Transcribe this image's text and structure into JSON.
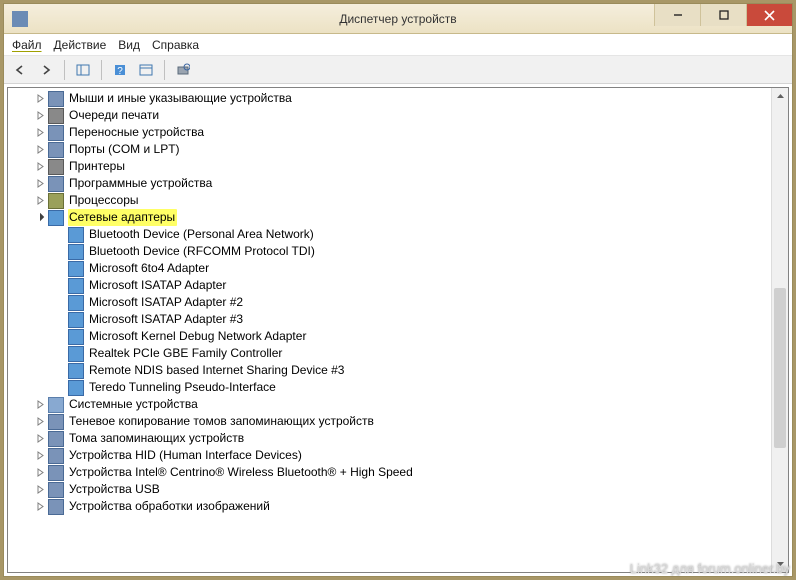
{
  "window": {
    "title": "Диспетчер устройств"
  },
  "menu": {
    "file": "Файл",
    "action": "Действие",
    "view": "Вид",
    "help": "Справка"
  },
  "tree": {
    "categories": [
      {
        "label": "Мыши и иные указывающие устройства",
        "expanded": false,
        "icon": "mouse"
      },
      {
        "label": "Очереди печати",
        "expanded": false,
        "icon": "printer"
      },
      {
        "label": "Переносные устройства",
        "expanded": false,
        "icon": "portable"
      },
      {
        "label": "Порты (COM и LPT)",
        "expanded": false,
        "icon": "port"
      },
      {
        "label": "Принтеры",
        "expanded": false,
        "icon": "printer"
      },
      {
        "label": "Программные устройства",
        "expanded": false,
        "icon": "soft"
      },
      {
        "label": "Процессоры",
        "expanded": false,
        "icon": "chip"
      },
      {
        "label": "Сетевые адаптеры",
        "expanded": true,
        "highlight": true,
        "icon": "net",
        "children": [
          {
            "label": "Bluetooth Device (Personal Area Network)"
          },
          {
            "label": "Bluetooth Device (RFCOMM Protocol TDI)"
          },
          {
            "label": "Microsoft 6to4 Adapter"
          },
          {
            "label": "Microsoft ISATAP Adapter"
          },
          {
            "label": "Microsoft ISATAP Adapter #2"
          },
          {
            "label": "Microsoft ISATAP Adapter #3"
          },
          {
            "label": "Microsoft Kernel Debug Network Adapter"
          },
          {
            "label": "Realtek PCIe GBE Family Controller"
          },
          {
            "label": "Remote NDIS based Internet Sharing Device #3"
          },
          {
            "label": "Teredo Tunneling Pseudo-Interface"
          }
        ]
      },
      {
        "label": "Системные устройства",
        "expanded": false,
        "icon": "sys"
      },
      {
        "label": "Теневое копирование томов запоминающих устройств",
        "expanded": false,
        "icon": "disk"
      },
      {
        "label": "Тома запоминающих устройств",
        "expanded": false,
        "icon": "disk"
      },
      {
        "label": "Устройства HID (Human Interface Devices)",
        "expanded": false,
        "icon": "hid"
      },
      {
        "label": "Устройства Intel® Centrino® Wireless Bluetooth® + High Speed",
        "expanded": false,
        "icon": "bt"
      },
      {
        "label": "Устройства USB",
        "expanded": false,
        "icon": "usb"
      },
      {
        "label": "Устройства обработки изображений",
        "expanded": false,
        "icon": "img"
      }
    ]
  },
  "watermark": "Link32 для forum.onliner.by"
}
